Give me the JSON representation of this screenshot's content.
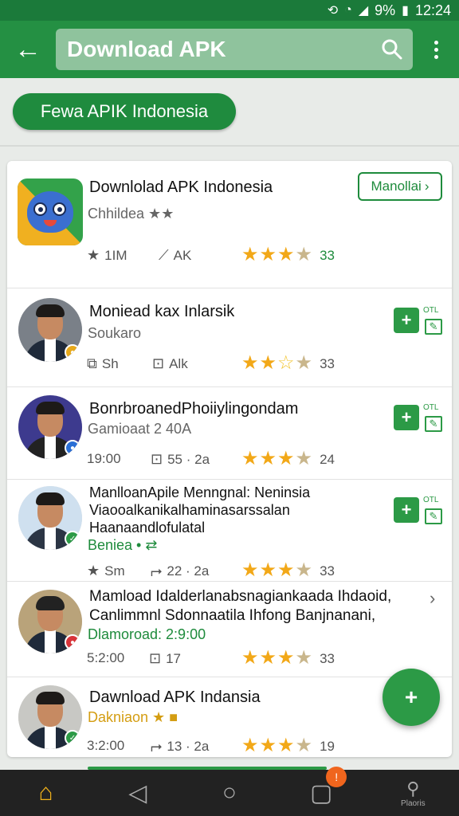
{
  "status": {
    "percent": "9%",
    "time": "12:24"
  },
  "appbar": {
    "search_text": "Download APK"
  },
  "chip": {
    "label": "Fewa APIK Indonesia"
  },
  "items": [
    {
      "title": "Downlolad APK Indonesia",
      "subtitle": "Chhildea ★★",
      "meta1": "1IM",
      "meta2": "AK",
      "rating_count": "33",
      "action_label": "Manollai"
    },
    {
      "title": "Moniead kax Inlarsik",
      "subtitle": "Soukaro",
      "meta1": "Sh",
      "meta2": "Alk",
      "rating_count": "33",
      "side_label": "OTL"
    },
    {
      "title": "BonrbroanedPhoiiylingondam",
      "subtitle": "Gamioaat 2 40A",
      "meta1": "19:00",
      "meta2": "55 · 2a",
      "rating_count": "24",
      "side_label": "OTL"
    },
    {
      "title_lines": [
        "ManlloanApile Menngnal: Neninsia",
        "Viaooalkanikalhaminasarssalan",
        "Haanaandlofulatal"
      ],
      "subtitle": "Beniea • ⇄",
      "meta1": "Sm",
      "meta2": "22 · 2a",
      "rating_count": "33",
      "side_label": "OTL"
    },
    {
      "title_lines": [
        "Mamload Idalderlanabsnagiankaada Ihdaoid,",
        "Canlimmnl Sdonnaatila Ihfong Banjnanani,"
      ],
      "subtitle": "Dlamoroad: 2:9:00",
      "meta1": "5:2:00",
      "meta2": "17",
      "rating_count": "33"
    },
    {
      "title": "Dawnload APK Indansia",
      "subtitle": "Dakniaon ★ ■",
      "meta1": "3:2:00",
      "meta2": "13 · 2a",
      "rating_count": "19"
    }
  ],
  "nav": {
    "badge": "!",
    "profile_label": "Plaoris"
  },
  "colors": {
    "primary": "#249043",
    "accent": "#f2a818"
  }
}
